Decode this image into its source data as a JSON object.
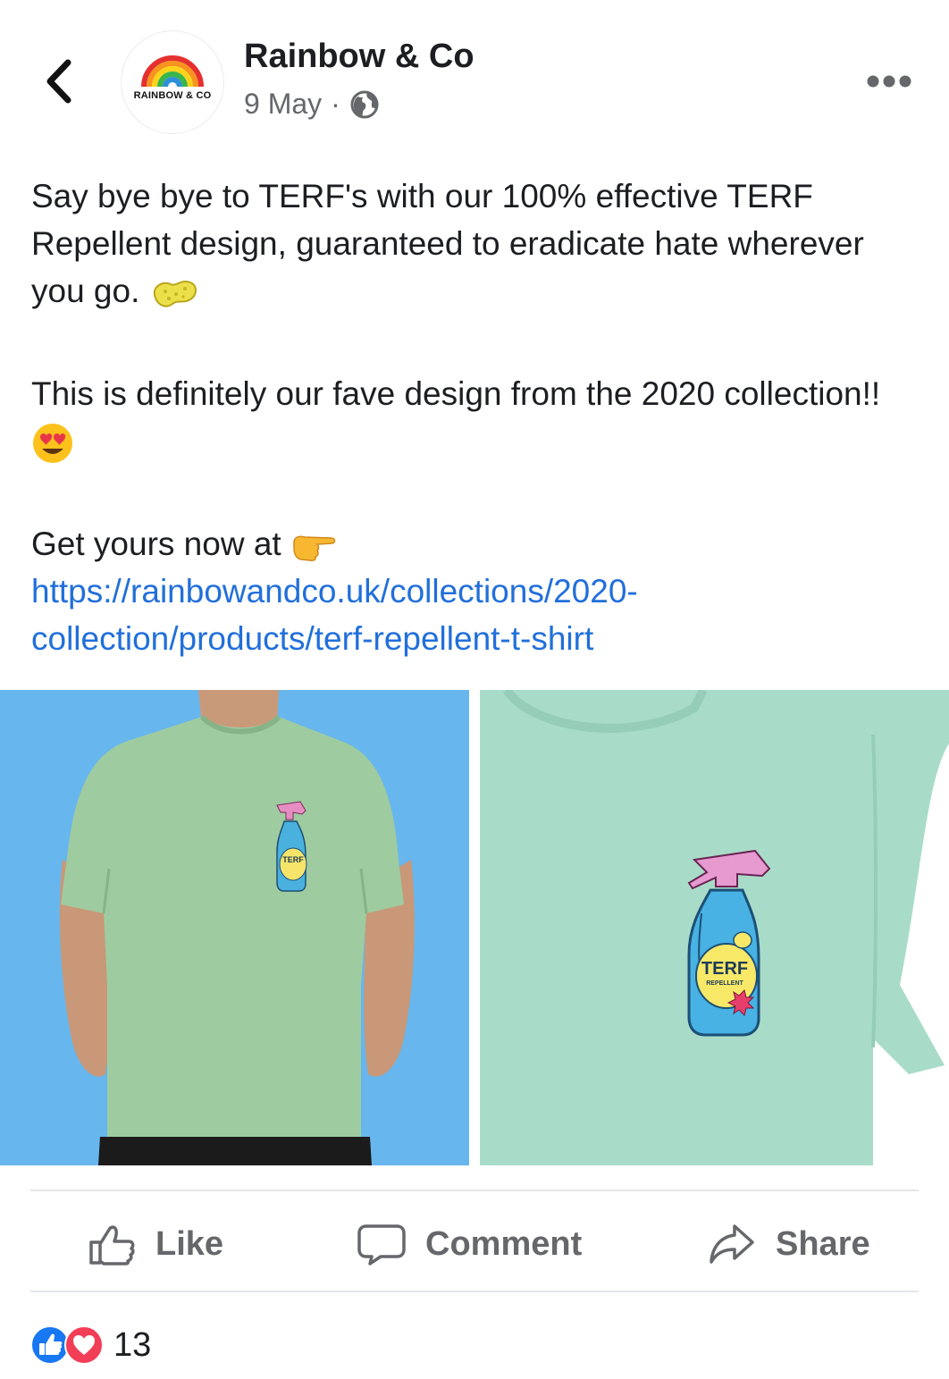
{
  "header": {
    "page_name": "Rainbow & Co",
    "avatar_text": "RAINBOW & CO",
    "date": "9 May",
    "separator": "·",
    "audience_icon": "globe-icon",
    "back_icon": "chevron-left-icon",
    "more_icon": "more-dots-icon"
  },
  "post": {
    "para1": "Say bye bye to TERF's with our 100% effective TERF Repellent design, guaranteed to eradicate hate wherever you go.",
    "para1_emoji": "sponge-emoji",
    "para2": "This is definitely our fave design from the 2020 collection!!",
    "para2_emoji": "heart-eyes-emoji",
    "para3_prefix": "Get yours now at",
    "para3_emoji": "pointing-right-emoji",
    "link": "https://rainbowandco.uk/collections/2020-collection/products/terf-repellent-t-shirt"
  },
  "images": {
    "left_label": "TERF",
    "right_label": "TERF",
    "right_sublabel": "REPELLENT",
    "background_left": "#67b6ee",
    "shirt_color": "#9fcba0"
  },
  "actions": {
    "like": "Like",
    "comment": "Comment",
    "share": "Share"
  },
  "reactions": {
    "count": "13",
    "icons": [
      "like-reaction-icon",
      "love-reaction-icon"
    ]
  },
  "colors": {
    "link": "#216fdb",
    "secondary_text": "#65676b",
    "like_blue": "#1877f2",
    "love_red": "#f33e58"
  }
}
